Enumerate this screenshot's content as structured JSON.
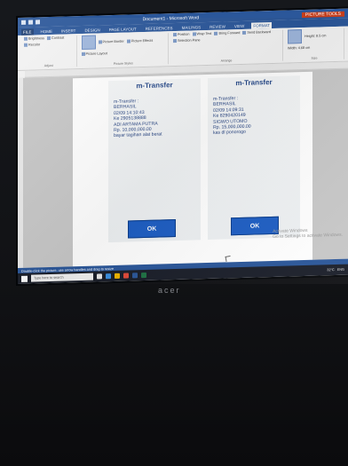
{
  "window": {
    "doc_title": "Document1 - Microsoft Word",
    "context_tab": "PICTURE TOOLS"
  },
  "ribbon_tabs": [
    "FILE",
    "HOME",
    "INSERT",
    "DESIGN",
    "PAGE LAYOUT",
    "REFERENCES",
    "MAILINGS",
    "REVIEW",
    "VIEW",
    "FORMAT"
  ],
  "ribbon": {
    "groups": [
      {
        "label": "Adjust",
        "buttons": [
          "Brightness",
          "Contrast",
          "Recolor"
        ]
      },
      {
        "label": "Picture Styles",
        "buttons": [
          "Picture Border",
          "Picture Effects",
          "Picture Layout"
        ]
      },
      {
        "label": "Arrange",
        "buttons": [
          "Position",
          "Wrap Text",
          "Bring Forward",
          "Send Backward",
          "Selection Pane"
        ]
      },
      {
        "label": "Size",
        "buttons": [
          "Crop",
          "Height: 8.5 cm",
          "Width: 4.68 cm"
        ]
      }
    ]
  },
  "page": {
    "shots": [
      {
        "title": "m-Transfer",
        "lines": [
          "m-Transfer :",
          "BERHASIL",
          "02/09 14:10:43",
          "Ke 2905138888",
          "ADI ARTAMA PUTRA",
          "Rp. 10,000,000.00",
          "bayar tagihan alat berat"
        ],
        "button": "OK"
      },
      {
        "title": "m-Transfer",
        "lines": [
          "m-Transfer :",
          "BERHASIL",
          "02/09 14:09:31",
          "Ke 8290420149",
          "SIGWO UTOMO",
          "Rp. 15,000,000.00",
          "kas dl ponorogo"
        ],
        "button": "OK"
      }
    ]
  },
  "statusbar": {
    "text": "Double-click the picture, use arrow handles and drag to resize"
  },
  "taskbar": {
    "search_placeholder": "Type here to search",
    "tray_temp": "32°C",
    "tray_lang": "ENG"
  },
  "watermark": {
    "line1": "Activate Windows",
    "line2": "Go to Settings to activate Windows."
  },
  "monitor": {
    "brand": "acer"
  }
}
